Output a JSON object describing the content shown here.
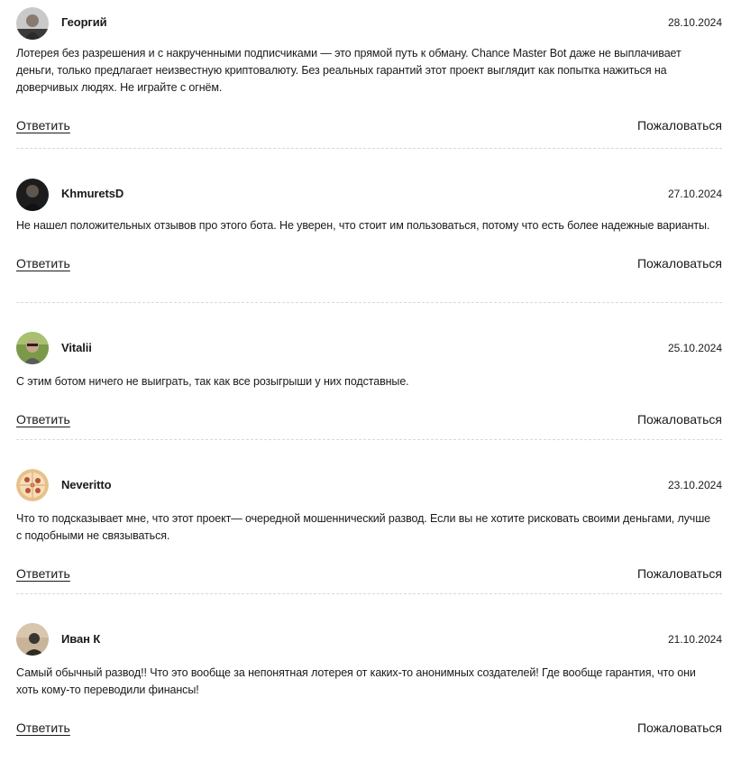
{
  "comments": [
    {
      "author": "Георгий",
      "date": "28.10.2024",
      "avatar": "user-photo-icon",
      "text": "Лотерея без разрешения и с накрученными подписчиками — это прямой путь к обману. Chance Master Bot даже не выплачивает деньги, только предлагает неизвестную криптовалюту. Без реальных гарантий этот проект выглядит как попытка нажиться на доверчивых людях. Не играйте с огнём.",
      "reply_label": "Ответить",
      "report_label": "Пожаловаться"
    },
    {
      "author": "KhmuretsD",
      "date": "27.10.2024",
      "avatar": "user-photo-icon",
      "text": "Не нашел положительных отзывов про этого бота. Не уверен, что стоит им пользоваться, потому что есть более надежные варианты.",
      "reply_label": "Ответить",
      "report_label": "Пожаловаться"
    },
    {
      "author": "Vitalii",
      "date": "25.10.2024",
      "avatar": "user-photo-icon",
      "text": "С этим ботом ничего не выиграть, так как все розыгрыши у них подставные.",
      "reply_label": "Ответить",
      "report_label": "Пожаловаться"
    },
    {
      "author": "Neveritto",
      "date": "23.10.2024",
      "avatar": "pizza-avatar-icon",
      "text": "Что то подсказывает мне, что этот проект— очередной мошеннический развод. Если вы не хотите рисковать своими деньгами, лучше с подобными не связываться.",
      "reply_label": "Ответить",
      "report_label": "Пожаловаться"
    },
    {
      "author": "Иван К",
      "date": "21.10.2024",
      "avatar": "user-photo-icon",
      "text": "Самый обычный развод!! Что это вообще за непонятная лотерея от каких-то анонимных создателей! Где вообще гарантия, что они хоть кому-то переводили финансы!",
      "reply_label": "Ответить",
      "report_label": "Пожаловаться"
    }
  ]
}
